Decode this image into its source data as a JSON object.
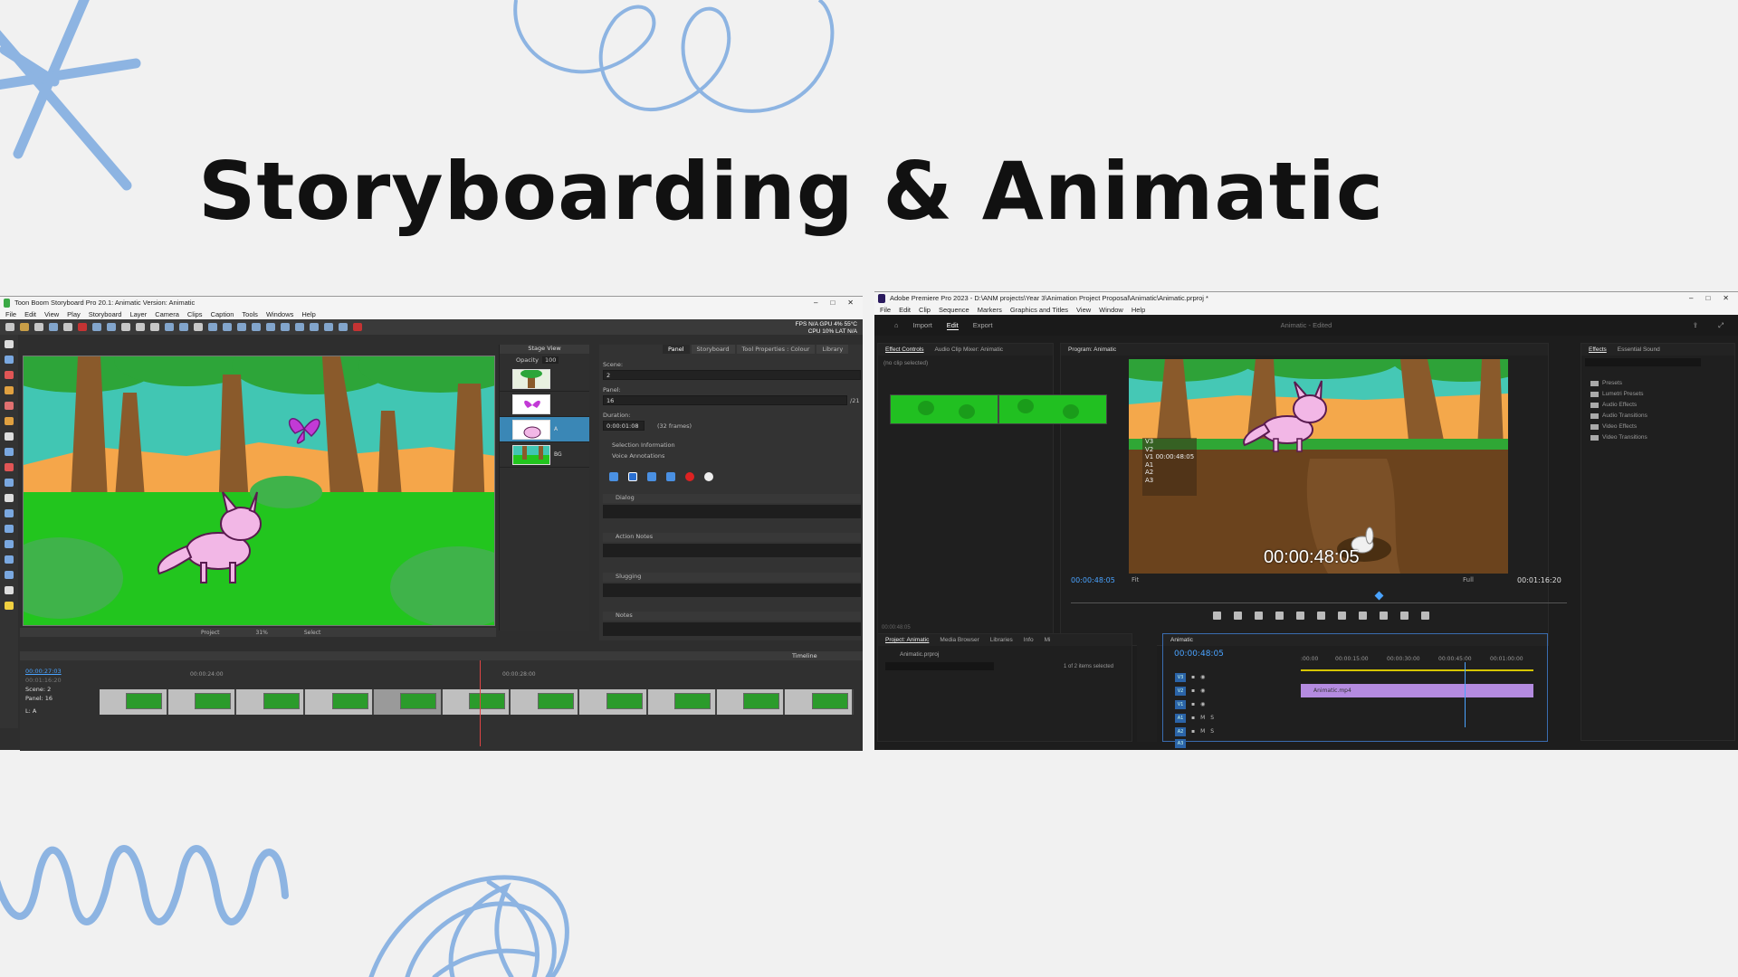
{
  "slide": {
    "title": "Storyboarding & Animatic",
    "accent": "#8db4e2"
  },
  "toonboom": {
    "window_title": "Toon Boom Storyboard Pro 20.1: Animatic Version: Animatic",
    "menu": [
      "File",
      "Edit",
      "View",
      "Play",
      "Storyboard",
      "Layer",
      "Camera",
      "Clips",
      "Caption",
      "Tools",
      "Windows",
      "Help"
    ],
    "stats": {
      "line1": "FPS N/A GPU 4% 55°C",
      "line2": "CPU 10% LAT N/A"
    },
    "thumbs_panel": {
      "header": "Stage View",
      "opacity_label": "Opacity",
      "opacity_value": "100",
      "layers": [
        {
          "label": ""
        },
        {
          "label": ""
        },
        {
          "label": "A"
        },
        {
          "label": "BG"
        }
      ]
    },
    "props": {
      "tabs": [
        "Panel",
        "Storyboard",
        "Tool Properties : Colour",
        "Library"
      ],
      "scene_label": "Scene:",
      "scene_value": "2",
      "panel_label": "Panel:",
      "panel_value": "16",
      "panel_total": "/21",
      "duration_label": "Duration:",
      "duration_value": "0:00:01:08",
      "duration_frames": "(32 frames)",
      "selection_info": "Selection Information",
      "voice_annotations": "Voice Annotations",
      "sections": [
        "Dialog",
        "Action Notes",
        "Slugging",
        "Notes"
      ]
    },
    "stagebar": {
      "project": "Project",
      "zoom": "31%",
      "select": "Select"
    },
    "timeline": {
      "title": "Timeline",
      "timecode": "00:00:27:03",
      "timecode_sub": "00:01:16:20",
      "scene": "Scene: 2",
      "panel": "Panel: 16",
      "layer": "L: A",
      "ruler": [
        "00:00:24:00",
        "00:00:28:00"
      ],
      "clip_count": 11
    }
  },
  "premiere": {
    "window_title": "Adobe Premiere Pro 2023 - D:\\ANM projects\\Year 3\\Animation Project Proposal\\Animatic\\Animatic.prproj *",
    "menu": [
      "File",
      "Edit",
      "Clip",
      "Sequence",
      "Markers",
      "Graphics and Titles",
      "View",
      "Window",
      "Help"
    ],
    "header_tabs": [
      "Import",
      "Edit",
      "Export"
    ],
    "active_tab": "Edit",
    "header_center": "Animatic  -  Edited",
    "effect_controls": {
      "tabs": [
        "Effect Controls",
        "Audio Clip Mixer: Animatic"
      ],
      "empty": "(no clip selected)",
      "footer_tc": "00:00:48:05"
    },
    "monitor": {
      "tab": "Program: Animatic",
      "tracks": [
        "V3",
        "V2",
        "V1 00:00:48:05",
        "A1",
        "A2",
        "A3"
      ],
      "timecode_big": "00:00:48:05",
      "timecode_left": "00:00:48:05",
      "timecode_right": "00:01:16:20",
      "fit": "Fit",
      "full": "Full",
      "playhead_fraction": 0.62
    },
    "effects": {
      "tabs": [
        "Effects",
        "Essential Sound"
      ],
      "items": [
        "Presets",
        "Lumetri Presets",
        "Audio Effects",
        "Audio Transitions",
        "Video Effects",
        "Video Transitions"
      ]
    },
    "project": {
      "tabs": [
        "Project: Animatic",
        "Media Browser",
        "Libraries",
        "Info",
        "Mi"
      ],
      "file": "Animatic.prproj",
      "selection": "1 of 2 items selected"
    },
    "sequence": {
      "tab": "Animatic",
      "timecode": "00:00:48:05",
      "ruler": [
        ":00:00",
        "00:00:15:00",
        "00:00:30:00",
        "00:00:45:00",
        "00:01:00:00"
      ],
      "clip_name": "Animatic.mp4",
      "tracks": [
        "V3",
        "V2",
        "V1",
        "A1",
        "A2",
        "A3"
      ]
    }
  }
}
